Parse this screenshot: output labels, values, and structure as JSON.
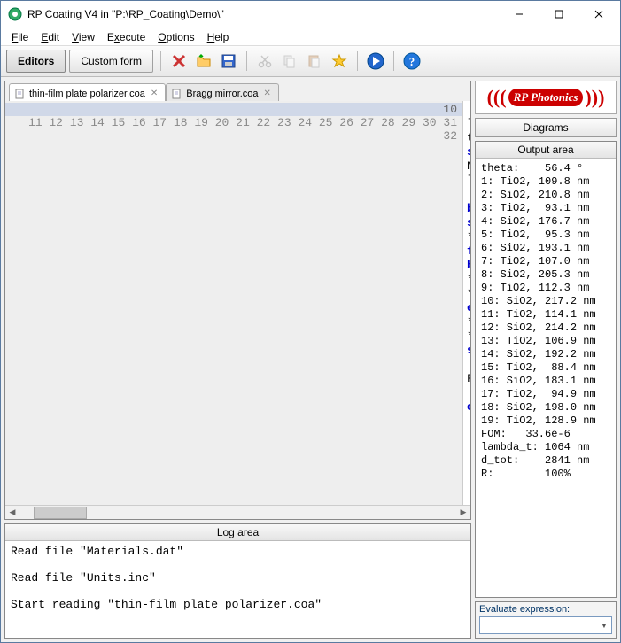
{
  "window": {
    "title": "RP Coating V4 in \"P:\\RP_Coating\\Demo\\\""
  },
  "menu": {
    "file": "File",
    "edit": "Edit",
    "view": "View",
    "execute": "Execute",
    "options": "Options",
    "help": "Help"
  },
  "toolbar": {
    "editors": "Editors",
    "custom": "Custom form"
  },
  "tabs": {
    "t1": "thin-film plate polarizer.coa",
    "t2": "Bragg mirror.coa"
  },
  "gutter": [
    "10",
    "11",
    "12",
    "13",
    "14",
    "15",
    "16",
    "17",
    "18",
    "19",
    "20",
    "21",
    "22",
    "23",
    "24",
    "25",
    "26",
    "27",
    "28",
    "29",
    "30",
    "31",
    "32"
  ],
  "panels": {
    "log": "Log area",
    "diagrams": "Diagrams",
    "output": "Output area",
    "eval": "Evaluate expression:"
  },
  "logo": "RP Photonics",
  "log_text": "Read file \"Materials.dat\"\n\nRead file \"Units.inc\"\n\nStart reading \"thin-film plate polarizer.coa\"",
  "output_text": "theta:    56.4 °\n1: TiO2, 109.8 nm\n2: SiO2, 210.8 nm\n3: TiO2,  93.1 nm\n4: SiO2, 176.7 nm\n5: TiO2,  95.3 nm\n6: SiO2, 193.1 nm\n7: TiO2, 107.0 nm\n8: SiO2, 205.3 nm\n9: TiO2, 112.3 nm\n10: SiO2, 217.2 nm\n11: TiO2, 114.1 nm\n12: SiO2, 214.2 nm\n13: TiO2, 106.9 nm\n14: SiO2, 192.2 nm\n15: TiO2,  88.4 nm\n16: SiO2, 183.1 nm\n17: TiO2,  94.9 nm\n18: SiO2, 198.0 nm\n19: TiO2, 128.9 nm\nFOM:   33.6e-6\nlambda_t: 1064 nm\nd_tot:    2841 nm\nR:        100%",
  "eval_value": ""
}
